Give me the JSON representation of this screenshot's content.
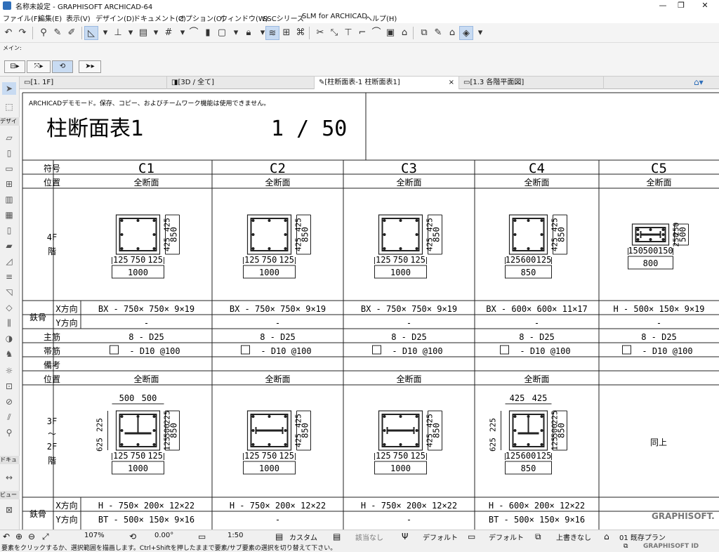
{
  "titlebar": {
    "title": "名称未設定 - GRAPHISOFT ARCHICAD-64",
    "minimize": "—",
    "maximize": "❐",
    "close": "✕"
  },
  "menu": [
    "ファイル(F)",
    "編集(E)",
    "表示(V)",
    "デザイン(D)",
    "ドキュメント(C)",
    "オプション(O)",
    "ウィンドウ(W)",
    "SSCシリーズ",
    "SLM for ARCHICAD",
    "ヘルプ(H)"
  ],
  "toolbar2": {
    "label": "メイン:"
  },
  "tabs": [
    {
      "label": "[1. 1F]"
    },
    {
      "label": "[3D / 全て]"
    },
    {
      "label": "[柱断面表-1 柱断面表1]",
      "close": "×"
    },
    {
      "label": "[1.3 各階平面図]"
    }
  ],
  "toolbox": {
    "design": "デザイ",
    "document": "ドキュ",
    "view": "ビュー"
  },
  "notice": "ARCHICADデモモード。保存、コピー、およびチームワーク機能は使用できません。",
  "sheet_title": "柱断面表1",
  "scale": "1 / 50",
  "columns": [
    "C1",
    "C2",
    "C3",
    "C4",
    "C5"
  ],
  "row_labels": {
    "mark": "符号",
    "position": "位置",
    "floor4_a": "4F",
    "floor4_b": "階",
    "steel": "鉄骨",
    "xdir": "X方向",
    "ydir": "Y方向",
    "main": "主筋",
    "hoop": "帯筋",
    "note": "備考",
    "floor3_a": "3F",
    "floor3_b": "～",
    "floor3_c": "2F",
    "floor3_d": "階"
  },
  "position_values": [
    "全断面",
    "全断面",
    "全断面",
    "全断面",
    "全断面"
  ],
  "upper": {
    "dims": [
      {
        "side": [
          "425",
          "425"
        ],
        "total": "850",
        "bottom": [
          "125",
          "750",
          "125"
        ],
        "width": "1000"
      },
      {
        "side": [
          "425",
          "425"
        ],
        "total": "850",
        "bottom": [
          "125",
          "750",
          "125"
        ],
        "width": "1000"
      },
      {
        "side": [
          "425",
          "425"
        ],
        "total": "850",
        "bottom": [
          "125",
          "750",
          "125"
        ],
        "width": "1000"
      },
      {
        "side": [
          "425",
          "425"
        ],
        "total": "850",
        "bottom": [
          "125",
          "600",
          "125"
        ],
        "width": "850"
      },
      {
        "side": [
          "250",
          "250"
        ],
        "total": "500",
        "bottom": [
          "150",
          "500",
          "150"
        ],
        "width": "800"
      }
    ],
    "steel_x": [
      "BX -  750× 750×  9×19",
      "BX -  750× 750×  9×19",
      "BX -  750× 750×  9×19",
      "BX -  600× 600× 11×17",
      "H -  500× 150×  9×19"
    ],
    "steel_y": [
      "-",
      "-",
      "-",
      "-",
      "-"
    ],
    "main_bar": [
      "8 - D25",
      "8 - D25",
      "8 - D25",
      "8 - D25",
      "8 - D25"
    ],
    "hoop": [
      "- D10 @100",
      "- D10 @100",
      "- D10 @100",
      "- D10 @100",
      "- D10 @100"
    ]
  },
  "lower": {
    "position_values": [
      "全断面",
      "全断面",
      "全断面",
      "全断面",
      ""
    ],
    "dims": [
      {
        "top": [
          "500",
          "500"
        ],
        "left": [
          "225",
          "625"
        ],
        "side": [
          "225",
          "500",
          "125"
        ],
        "total": "850",
        "bottom": [
          "125",
          "750",
          "125"
        ],
        "width": "1000"
      },
      {
        "side": [
          "425",
          "425"
        ],
        "total": "850",
        "bottom": [
          "125",
          "750",
          "125"
        ],
        "width": "1000"
      },
      {
        "side": [
          "425",
          "425"
        ],
        "total": "850",
        "bottom": [
          "125",
          "750",
          "125"
        ],
        "width": "1000"
      },
      {
        "top": [
          "425",
          "425"
        ],
        "left": [
          "225",
          "625"
        ],
        "side": [
          "225",
          "500",
          "125"
        ],
        "total": "850",
        "bottom": [
          "125",
          "600",
          "125"
        ],
        "width": "850"
      }
    ],
    "same_as_above": "同上",
    "steel_x": [
      "H -  750× 200× 12×22",
      "H -  750× 200× 12×22",
      "H -  750× 200× 12×22",
      "H -  600× 200× 12×22",
      ""
    ],
    "steel_y": [
      "BT -  500× 150×  9×16",
      "-",
      "-",
      "BT -  500× 150×  9×16",
      ""
    ]
  },
  "watermark": "GRAPHISOFT.",
  "status": {
    "zoom": "107%",
    "angle": "0.00°",
    "scale": "1:50",
    "layer": "カスタム",
    "model": "該当なし",
    "pen": "デフォルト",
    "pen2": "デフォルト",
    "override": "上書きなし",
    "view": "01 既存プラン"
  },
  "hint": "要素をクリックするか、選択範囲を描画します。Ctrl+Shiftを押したままで要素/サブ要素の選択を切り替えて下さい。",
  "brand": "GRAPHISOFT ID"
}
